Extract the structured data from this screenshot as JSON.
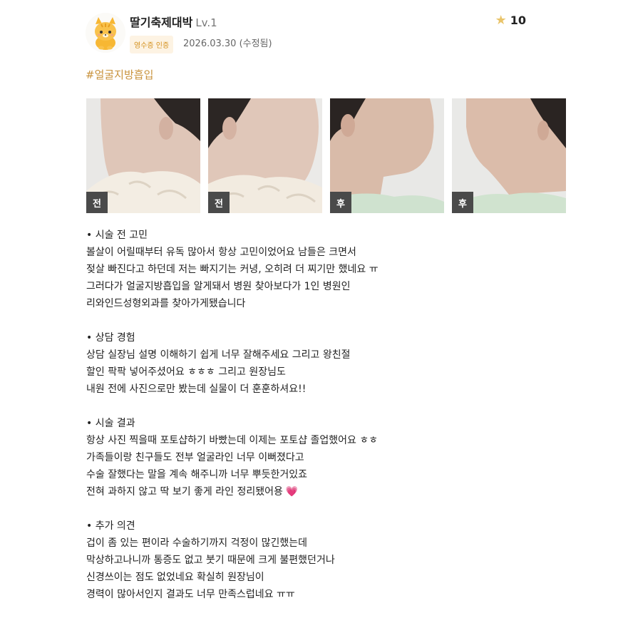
{
  "user": {
    "nickname": "딸기축제대박",
    "level": "Lv.1",
    "badge": "영수증 인증",
    "date": "2026.03.30 (수정됨)",
    "avatar_icon": "cat-avatar-icon"
  },
  "rating": {
    "value": "10",
    "icon": "star-icon",
    "color": "#e9c46a"
  },
  "hashtag": "#얼굴지방흡입",
  "photos": [
    {
      "label": "전"
    },
    {
      "label": "전"
    },
    {
      "label": "후"
    },
    {
      "label": "후"
    }
  ],
  "sections": [
    {
      "title": "• 시술 전 고민",
      "lines": [
        "볼살이 어릴때부터 유독 많아서 항상 고민이었어요 남들은 크면서",
        "젖살 빠진다고 하던데 저는 빠지기는 커녕, 오히려 더 찌기만 했네요 ㅠ",
        "그러다가 얼굴지방흡입을 알게돼서 병원 찾아보다가 1인 병원인",
        "리와인드성형외과를 찾아가게됐습니다"
      ]
    },
    {
      "title": "• 상담 경험",
      "lines": [
        "상담 실장님 설명 이해하기 쉽게 너무 잘해주세요 그리고 왕친절",
        "할인 팍팍 넣어주셨어요 ㅎㅎㅎ 그리고 원장님도",
        "내원 전에 사진으로만 봤는데 실물이 더 훈훈하셔요!!"
      ]
    },
    {
      "title": "• 시술 결과",
      "lines": [
        "항상 사진 찍을때 포토샵하기 바빴는데 이제는 포토샵 졸업했어요 ㅎㅎ",
        "가족들이랑 친구들도 전부 얼굴라인 너무 이뻐졌다고",
        "수술 잘했다는 말을 계속 해주니까 너무 뿌듯한거있죠",
        "전혀 과하지 않고 딱 보기 좋게 라인 정리됐어용"
      ],
      "emoji": "💗"
    },
    {
      "title": "• 추가 의견",
      "lines": [
        "겁이 좀 있는 편이라 수술하기까지 걱정이 많긴했는데",
        "막상하고나니까 통증도 없고 붓기 때문에 크게 불편했던거나",
        "신경쓰이는 점도 없었네요 확실히 원장님이",
        "경력이 많아서인지 결과도 너무 만족스럽네요 ㅠㅠ"
      ]
    }
  ]
}
